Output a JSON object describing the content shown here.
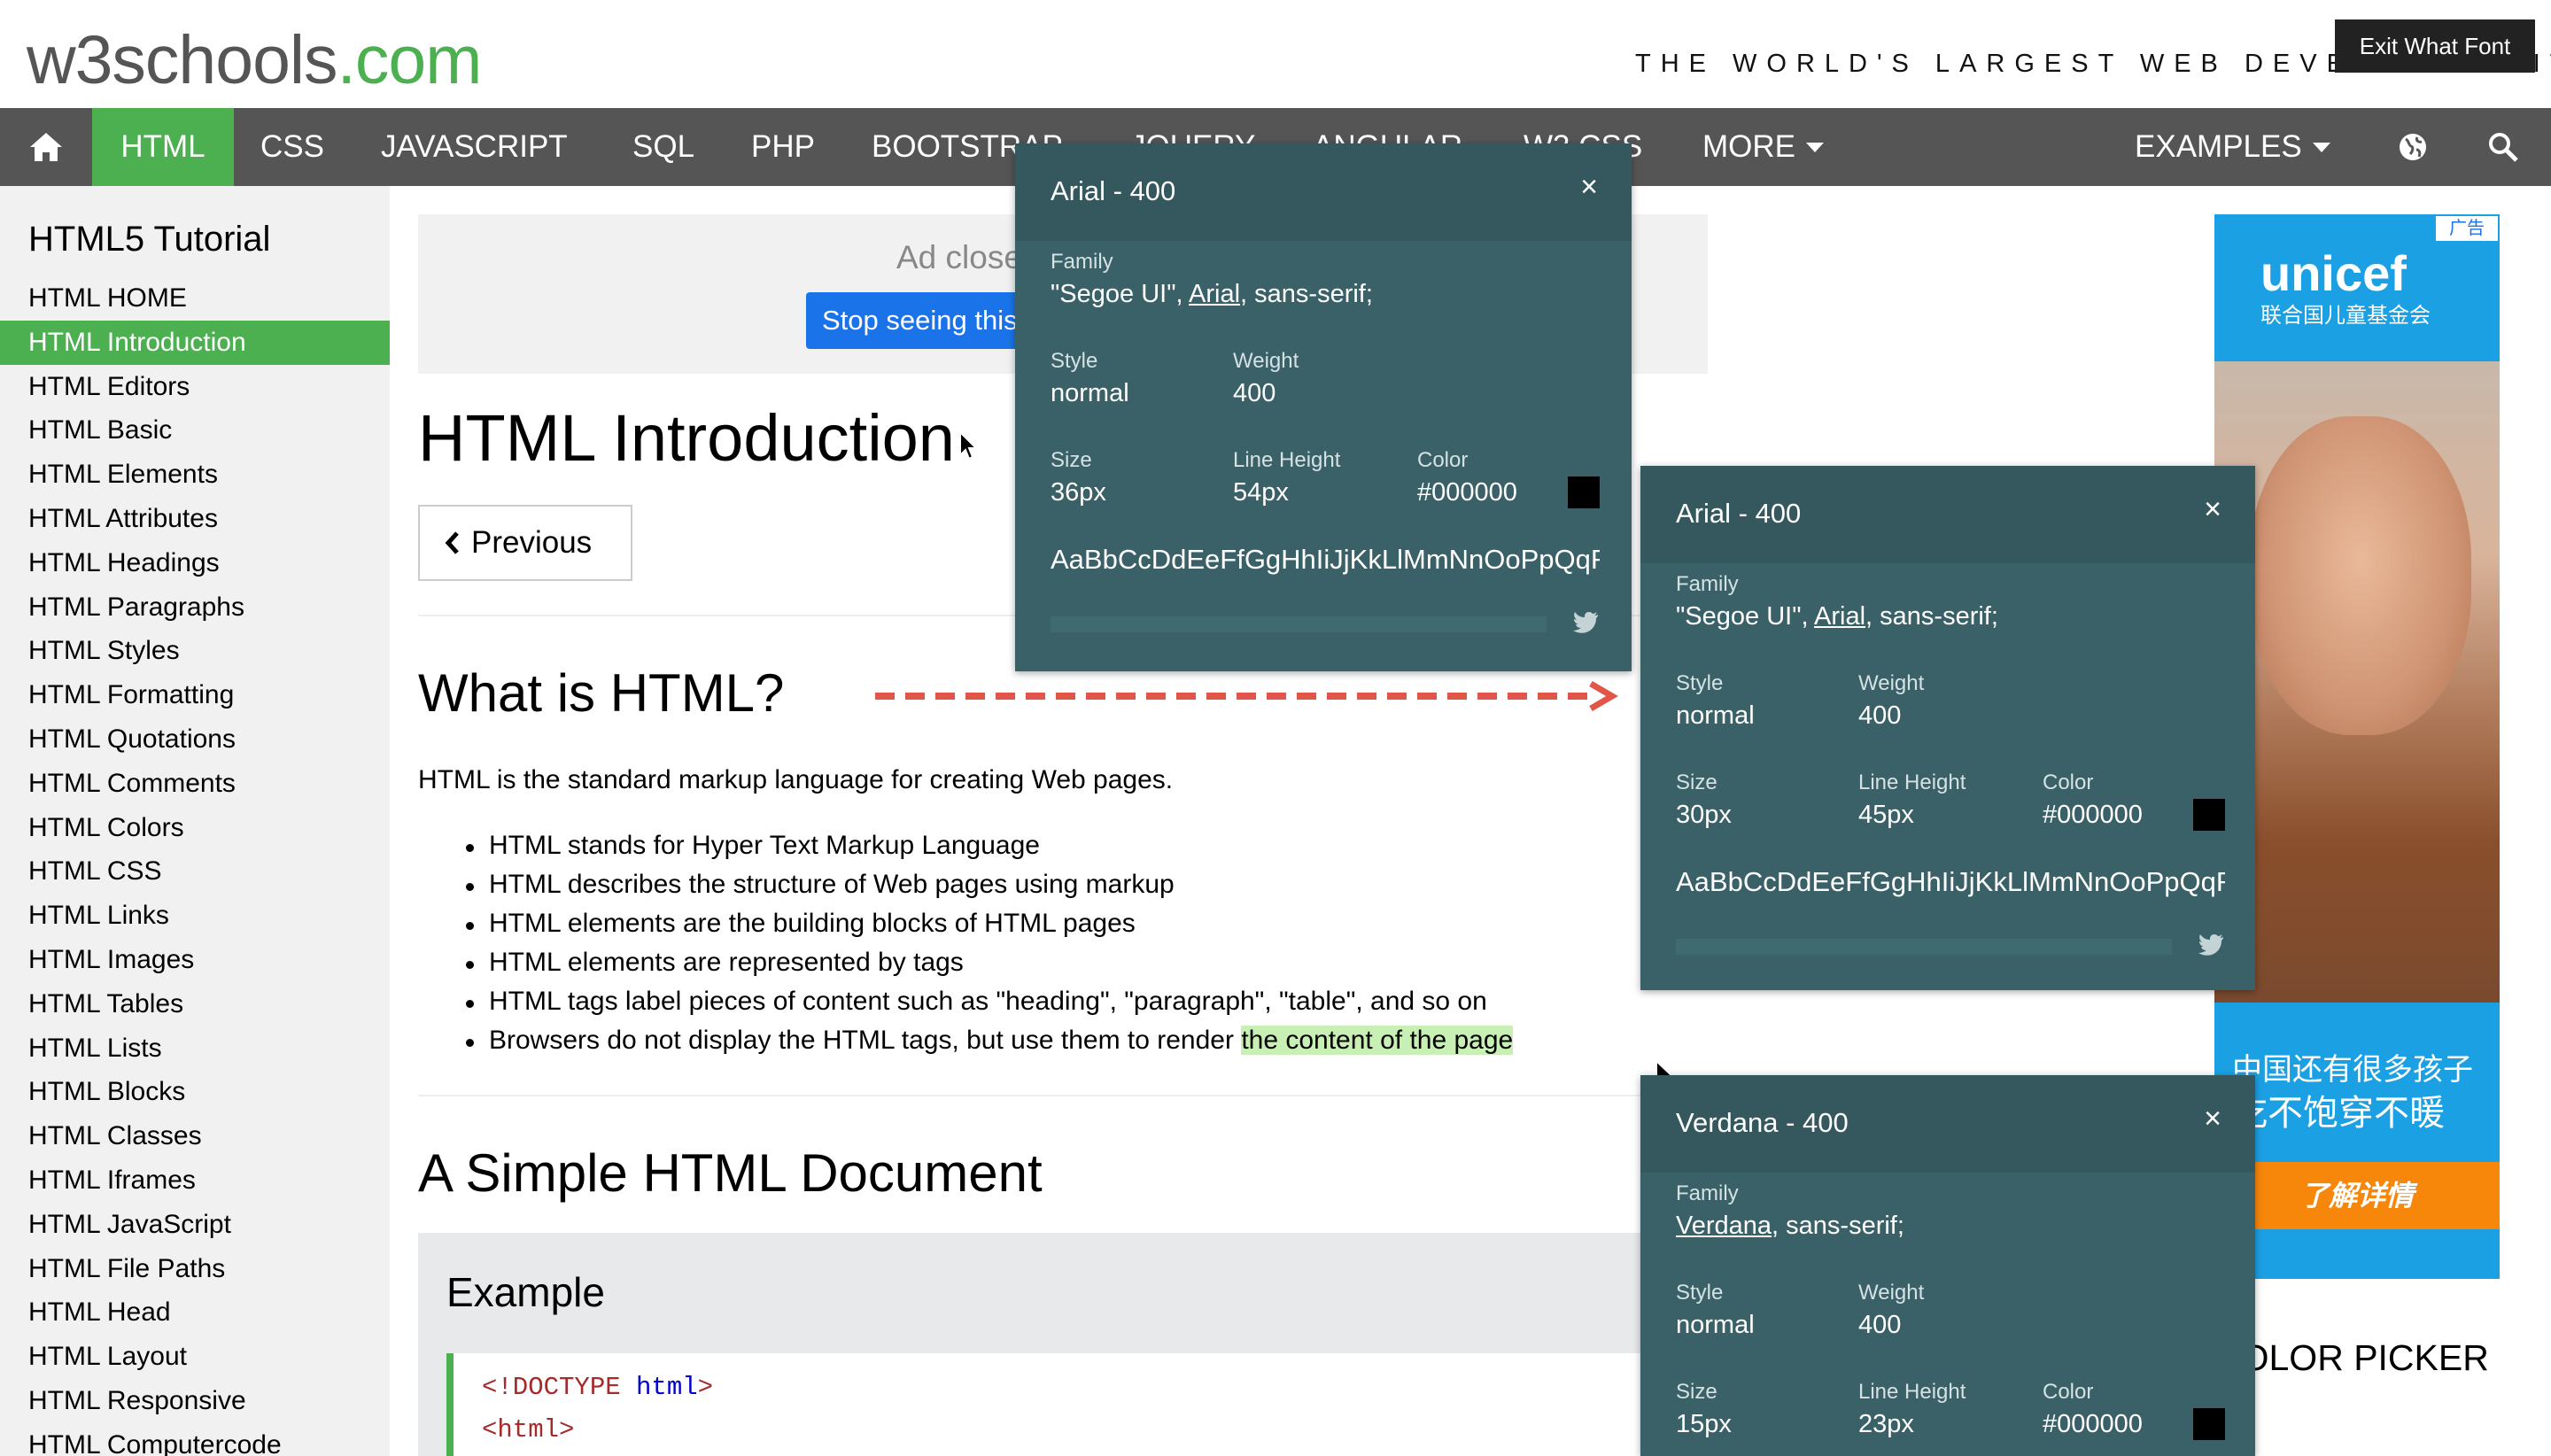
{
  "header": {
    "logo_main": "w3schools",
    "logo_domain": ".com",
    "tagline": "THE WORLD'S LARGEST WEB DEVELOPER SITE",
    "exit_button": "Exit What Font"
  },
  "nav": {
    "items": [
      "HTML",
      "CSS",
      "JAVASCRIPT",
      "SQL",
      "PHP",
      "BOOTSTRAP",
      "JQUERY",
      "ANGULAR",
      "W3.CSS",
      "MORE"
    ],
    "examples": "EXAMPLES",
    "accent": "#4CAF50",
    "bar_color": "#555555"
  },
  "sidebar": {
    "title": "HTML5 Tutorial",
    "items": [
      "HTML HOME",
      "HTML Introduction",
      "HTML Editors",
      "HTML Basic",
      "HTML Elements",
      "HTML Attributes",
      "HTML Headings",
      "HTML Paragraphs",
      "HTML Styles",
      "HTML Formatting",
      "HTML Quotations",
      "HTML Comments",
      "HTML Colors",
      "HTML CSS",
      "HTML Links",
      "HTML Images",
      "HTML Tables",
      "HTML Lists",
      "HTML Blocks",
      "HTML Classes",
      "HTML Iframes",
      "HTML JavaScript",
      "HTML File Paths",
      "HTML Head",
      "HTML Layout",
      "HTML Responsive",
      "HTML Computercode"
    ],
    "active_index": 1
  },
  "main": {
    "ad_closed": "Ad closed",
    "stop_seeing": "Stop seeing this ad",
    "title": "HTML Introduction",
    "previous": "Previous",
    "section1": "What is HTML?",
    "intro": "HTML is the standard markup language for creating Web pages.",
    "bullets": [
      "HTML stands for Hyper Text Markup Language",
      "HTML describes the structure of Web pages using markup",
      "HTML elements are the building blocks of HTML pages",
      "HTML elements are represented by tags",
      "HTML tags label pieces of content such as \"heading\", \"paragraph\", \"table\", and so on"
    ],
    "last_bullet_plain": "Browsers do not display the HTML tags, but use them to render ",
    "last_bullet_highlight": "the content of the page",
    "section2": "A Simple HTML Document",
    "example_title": "Example",
    "code_line1_open": "<!DOCTYPE ",
    "code_line1_kw": "html",
    "code_line1_close": ">",
    "code_line2": "<html>"
  },
  "popups": [
    {
      "title": "Arial - 400",
      "family_quoted": "\"Segoe UI\", ",
      "family_match": "Arial",
      "family_rest": ", sans-serif;",
      "style": "normal",
      "weight": "400",
      "size": "36px",
      "line_height": "54px",
      "color": "#000000",
      "sample": "AaBbCcDdEeFfGgHhIiJjKkLlMmNnOoPpQqRrSsTtUuVvWwXxYyZz"
    },
    {
      "title": "Arial - 400",
      "family_quoted": "\"Segoe UI\", ",
      "family_match": "Arial",
      "family_rest": ", sans-serif;",
      "style": "normal",
      "weight": "400",
      "size": "30px",
      "line_height": "45px",
      "color": "#000000",
      "sample": "AaBbCcDdEeFfGgHhIiJjKkLlMmNnOoPpQqRrSsTtUuVvWwXxYyZz"
    },
    {
      "title": "Verdana - 400",
      "family_quoted": "",
      "family_match": "Verdana",
      "family_rest": ", sans-serif;",
      "style": "normal",
      "weight": "400",
      "size": "15px",
      "line_height": "23px",
      "color": "#000000"
    }
  ],
  "popup_labels": {
    "family": "Family",
    "style": "Style",
    "weight": "Weight",
    "size": "Size",
    "line_height": "Line Height",
    "color": "Color",
    "close": "×"
  },
  "ad": {
    "tag": "广告",
    "brand": "unicef",
    "brand_sub": "联合国儿童基金会",
    "line1": "中国还有很多孩子",
    "line2": "吃不饱穿不暖",
    "cta": "了解详情"
  },
  "color_picker": "COLOR PICKER"
}
